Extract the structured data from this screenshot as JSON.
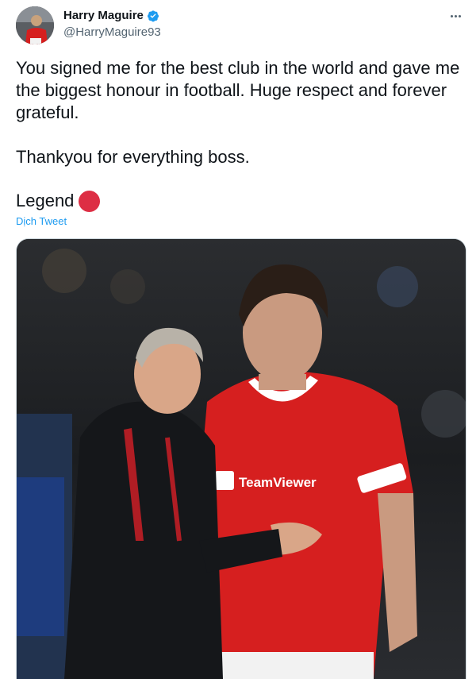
{
  "author": {
    "display_name": "Harry Maguire",
    "handle": "@HarryMaguire93",
    "verified": true,
    "avatar_icon": "profile-photo"
  },
  "more_icon": "ellipsis-icon",
  "tweet": {
    "paragraph_1": "You signed me for the best club in the world and gave me the biggest honour in football. Huge respect and forever grateful.",
    "paragraph_2": "Thankyou for everything boss.",
    "legend_word": "Legend",
    "legend_emoji": "red-circle-emoji",
    "translate_link": "Dịch Tweet"
  },
  "media": {
    "type": "photo",
    "description_icon": "photo-two-men-embracing-stadium"
  },
  "colors": {
    "text_primary": "#0f1419",
    "text_secondary": "#536471",
    "link_blue": "#1d9bf0",
    "verified_blue": "#1d9bf0",
    "emoji_red": "#dd2e44",
    "kit_red": "#d61f1f",
    "jacket_black": "#15171a"
  }
}
